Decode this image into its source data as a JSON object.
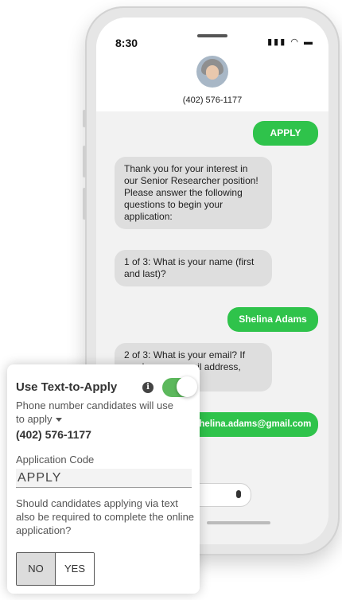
{
  "phone": {
    "status_time": "8:30",
    "contact_number": "(402) 576-1177",
    "messages": [
      {
        "type": "outgoing",
        "text": "APPLY"
      },
      {
        "type": "incoming",
        "text": "Thank you for your interest in our Senior Researcher position! Please answer the following questions to begin your application:"
      },
      {
        "type": "incoming",
        "text": "1 of 3: What is your name (first and last)?"
      },
      {
        "type": "outgoing",
        "text": "Shelina Adams"
      },
      {
        "type": "incoming",
        "text": "2 of 3: What is your email? If you have an email address, reply with NONE."
      },
      {
        "type": "outgoing",
        "text": "shelina.adams@gmail.com"
      }
    ]
  },
  "settings": {
    "title": "Use Text-to-Apply",
    "toggle_on": true,
    "phone_label": "Phone number candidates will use to apply",
    "phone_value": "(402) 576-1177",
    "code_label": "Application Code",
    "code_value": "APPLY",
    "question": "Should candidates applying via text also be required to complete the online application?",
    "no_label": "NO",
    "yes_label": "YES",
    "selected": "NO"
  },
  "colors": {
    "outgoing": "#2fc34b",
    "toggle": "#5cb85c"
  }
}
